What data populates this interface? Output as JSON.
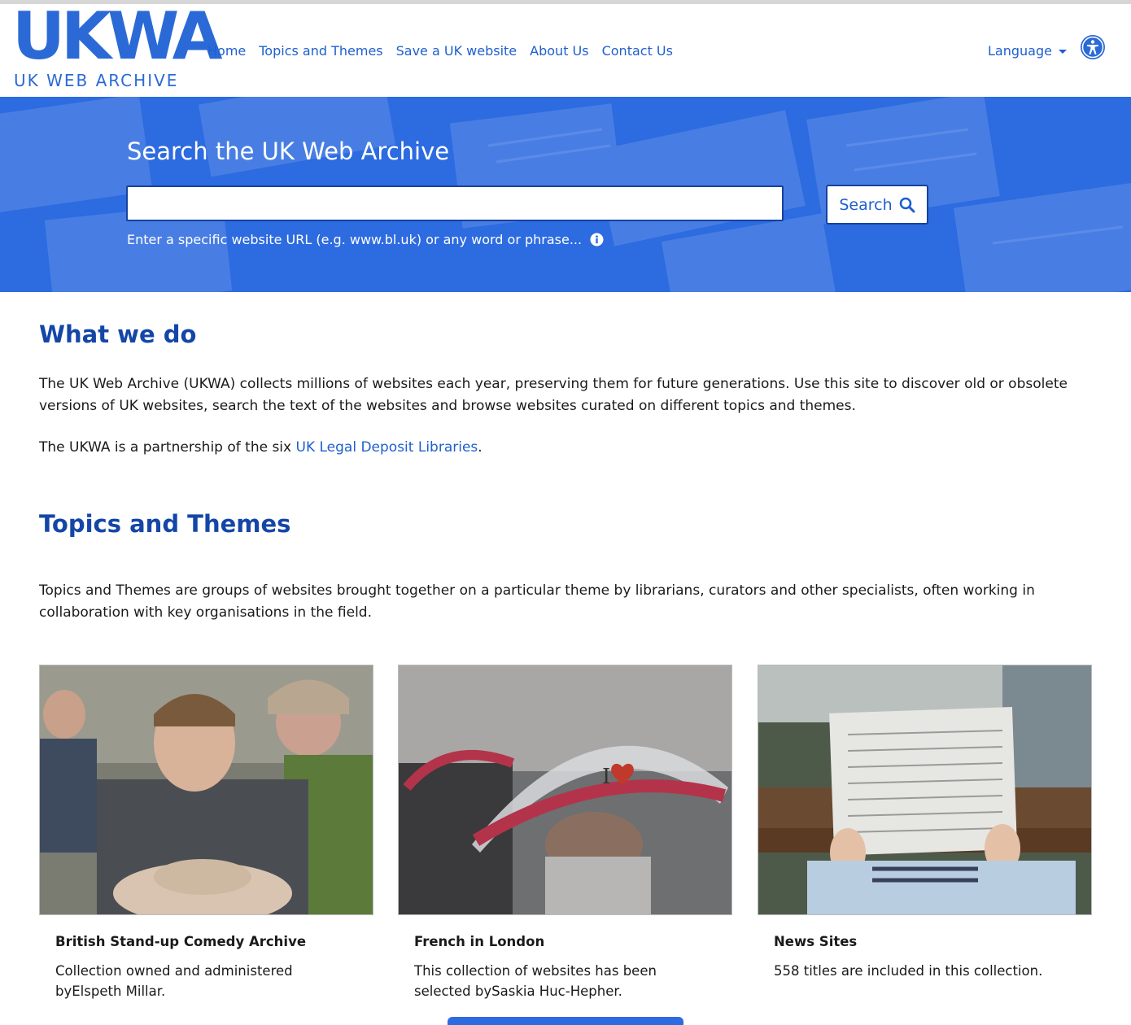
{
  "logo": {
    "mark": "UKWA",
    "subtitle": "UK WEB ARCHIVE"
  },
  "nav": {
    "items": [
      {
        "label": "Home"
      },
      {
        "label": "Topics and Themes"
      },
      {
        "label": "Save a UK website"
      },
      {
        "label": "About Us"
      },
      {
        "label": "Contact Us"
      }
    ],
    "language_label": "Language"
  },
  "icons": {
    "accessibility": "accessibility-icon",
    "search": "search-icon",
    "info": "info-icon",
    "dropdown": "caret-down-icon"
  },
  "hero": {
    "title": "Search the UK Web Archive",
    "search_value": "",
    "search_button": "Search",
    "hint": "Enter a specific website URL (e.g. www.bl.uk) or any word or phrase..."
  },
  "what_we_do": {
    "heading": "What we do",
    "paragraph": "The UK Web Archive (UKWA) collects millions of websites each year, preserving them for future generations. Use this site to discover old or obsolete versions of UK websites, search the text of the websites and browse websites curated on different topics and themes.",
    "partnership_prefix": "The UKWA is a partnership of the six ",
    "partnership_link": "UK Legal Deposit Libraries",
    "partnership_suffix": "."
  },
  "topics": {
    "heading": "Topics and Themes",
    "paragraph": "Topics and Themes are groups of websites brought together on a particular theme by librarians, curators and other specialists, often working in collaboration with key organisations in the field.",
    "cards": [
      {
        "title": "British Stand-up Comedy Archive",
        "description": "Collection owned and administered byElspeth Millar."
      },
      {
        "title": "French in London",
        "description": "This collection of websites has been selected bySaskia Huc-Hepher."
      },
      {
        "title": "News Sites",
        "description": "558 titles are included in this collection."
      }
    ]
  },
  "colors": {
    "brand_blue": "#2b6ad6",
    "link_blue": "#1f5fd0",
    "heading_blue": "#1446a8",
    "hero_blue": "#2d6be0"
  }
}
